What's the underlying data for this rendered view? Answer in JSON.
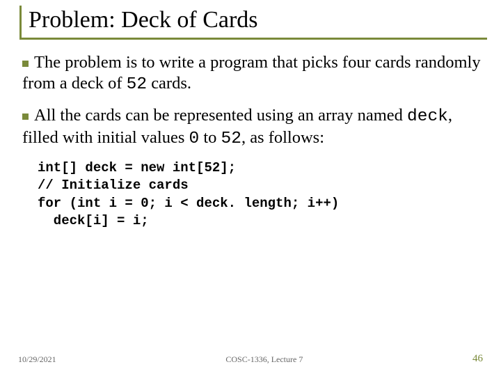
{
  "title": "Problem: Deck of Cards",
  "para1": {
    "pre": "The problem is to write a program that picks four cards randomly from a deck of ",
    "code": "52",
    "post": " cards."
  },
  "para2": {
    "pre": "All the cards can be represented using an array named ",
    "code1": "deck",
    "mid1": ", filled with initial values ",
    "code2": "0",
    "mid2": " to ",
    "code3": "52",
    "post": ", as follows:"
  },
  "code": "int[] deck = new int[52];\n// Initialize cards\nfor (int i = 0; i < deck. length; i++)\n  deck[i] = i;",
  "footer": {
    "date": "10/29/2021",
    "course": "COSC-1336, Lecture 7",
    "page": "46"
  }
}
